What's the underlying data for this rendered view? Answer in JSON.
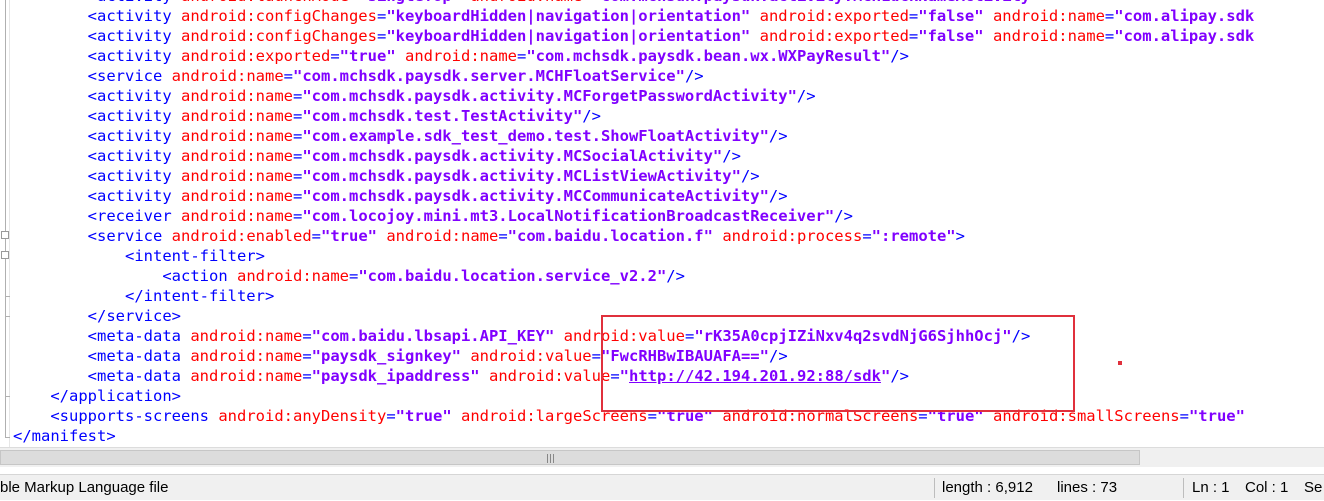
{
  "editor": {
    "lines": [
      [
        {
          "c": "p",
          "t": "<"
        },
        {
          "c": "t",
          "t": "activity"
        },
        {
          "c": "",
          "t": " "
        },
        {
          "c": "a",
          "t": "android:launchMode"
        },
        {
          "c": "p",
          "t": "="
        },
        {
          "c": "v",
          "t": "\"singleTop\""
        },
        {
          "c": "",
          "t": " "
        },
        {
          "c": "a",
          "t": "android:name"
        },
        {
          "c": "p",
          "t": "="
        },
        {
          "c": "v",
          "t": "\"com.mchsdk.paysdk.activity.MCHLuckNameActivity\""
        }
      ],
      [
        {
          "c": "p",
          "t": "<"
        },
        {
          "c": "t",
          "t": "activity"
        },
        {
          "c": "",
          "t": " "
        },
        {
          "c": "a",
          "t": "android:configChanges"
        },
        {
          "c": "p",
          "t": "="
        },
        {
          "c": "v",
          "t": "\"keyboardHidden|navigation|orientation\""
        },
        {
          "c": "",
          "t": " "
        },
        {
          "c": "a",
          "t": "android:exported"
        },
        {
          "c": "p",
          "t": "="
        },
        {
          "c": "v",
          "t": "\"false\""
        },
        {
          "c": "",
          "t": " "
        },
        {
          "c": "a",
          "t": "android:name"
        },
        {
          "c": "p",
          "t": "="
        },
        {
          "c": "v",
          "t": "\"com.alipay.sdk"
        }
      ],
      [
        {
          "c": "p",
          "t": "<"
        },
        {
          "c": "t",
          "t": "activity"
        },
        {
          "c": "",
          "t": " "
        },
        {
          "c": "a",
          "t": "android:configChanges"
        },
        {
          "c": "p",
          "t": "="
        },
        {
          "c": "v",
          "t": "\"keyboardHidden|navigation|orientation\""
        },
        {
          "c": "",
          "t": " "
        },
        {
          "c": "a",
          "t": "android:exported"
        },
        {
          "c": "p",
          "t": "="
        },
        {
          "c": "v",
          "t": "\"false\""
        },
        {
          "c": "",
          "t": " "
        },
        {
          "c": "a",
          "t": "android:name"
        },
        {
          "c": "p",
          "t": "="
        },
        {
          "c": "v",
          "t": "\"com.alipay.sdk"
        }
      ],
      [
        {
          "c": "p",
          "t": "<"
        },
        {
          "c": "t",
          "t": "activity"
        },
        {
          "c": "",
          "t": " "
        },
        {
          "c": "a",
          "t": "android:exported"
        },
        {
          "c": "p",
          "t": "="
        },
        {
          "c": "v",
          "t": "\"true\""
        },
        {
          "c": "",
          "t": " "
        },
        {
          "c": "a",
          "t": "android:name"
        },
        {
          "c": "p",
          "t": "="
        },
        {
          "c": "v",
          "t": "\"com.mchsdk.paysdk.bean.wx.WXPayResult\""
        },
        {
          "c": "p",
          "t": "/>"
        }
      ],
      [
        {
          "c": "p",
          "t": "<"
        },
        {
          "c": "t",
          "t": "service"
        },
        {
          "c": "",
          "t": " "
        },
        {
          "c": "a",
          "t": "android:name"
        },
        {
          "c": "p",
          "t": "="
        },
        {
          "c": "v",
          "t": "\"com.mchsdk.paysdk.server.MCHFloatService\""
        },
        {
          "c": "p",
          "t": "/>"
        }
      ],
      [
        {
          "c": "p",
          "t": "<"
        },
        {
          "c": "t",
          "t": "activity"
        },
        {
          "c": "",
          "t": " "
        },
        {
          "c": "a",
          "t": "android:name"
        },
        {
          "c": "p",
          "t": "="
        },
        {
          "c": "v",
          "t": "\"com.mchsdk.paysdk.activity.MCForgetPasswordActivity\""
        },
        {
          "c": "p",
          "t": "/>"
        }
      ],
      [
        {
          "c": "p",
          "t": "<"
        },
        {
          "c": "t",
          "t": "activity"
        },
        {
          "c": "",
          "t": " "
        },
        {
          "c": "a",
          "t": "android:name"
        },
        {
          "c": "p",
          "t": "="
        },
        {
          "c": "v",
          "t": "\"com.mchsdk.test.TestActivity\""
        },
        {
          "c": "p",
          "t": "/>"
        }
      ],
      [
        {
          "c": "p",
          "t": "<"
        },
        {
          "c": "t",
          "t": "activity"
        },
        {
          "c": "",
          "t": " "
        },
        {
          "c": "a",
          "t": "android:name"
        },
        {
          "c": "p",
          "t": "="
        },
        {
          "c": "v",
          "t": "\"com.example.sdk_test_demo.test.ShowFloatActivity\""
        },
        {
          "c": "p",
          "t": "/>"
        }
      ],
      [
        {
          "c": "p",
          "t": "<"
        },
        {
          "c": "t",
          "t": "activity"
        },
        {
          "c": "",
          "t": " "
        },
        {
          "c": "a",
          "t": "android:name"
        },
        {
          "c": "p",
          "t": "="
        },
        {
          "c": "v",
          "t": "\"com.mchsdk.paysdk.activity.MCSocialActivity\""
        },
        {
          "c": "p",
          "t": "/>"
        }
      ],
      [
        {
          "c": "p",
          "t": "<"
        },
        {
          "c": "t",
          "t": "activity"
        },
        {
          "c": "",
          "t": " "
        },
        {
          "c": "a",
          "t": "android:name"
        },
        {
          "c": "p",
          "t": "="
        },
        {
          "c": "v",
          "t": "\"com.mchsdk.paysdk.activity.MCListViewActivity\""
        },
        {
          "c": "p",
          "t": "/>"
        }
      ],
      [
        {
          "c": "p",
          "t": "<"
        },
        {
          "c": "t",
          "t": "activity"
        },
        {
          "c": "",
          "t": " "
        },
        {
          "c": "a",
          "t": "android:name"
        },
        {
          "c": "p",
          "t": "="
        },
        {
          "c": "v",
          "t": "\"com.mchsdk.paysdk.activity.MCCommunicateActivity\""
        },
        {
          "c": "p",
          "t": "/>"
        }
      ],
      [
        {
          "c": "p",
          "t": "<"
        },
        {
          "c": "t",
          "t": "receiver"
        },
        {
          "c": "",
          "t": " "
        },
        {
          "c": "a",
          "t": "android:name"
        },
        {
          "c": "p",
          "t": "="
        },
        {
          "c": "v",
          "t": "\"com.locojoy.mini.mt3.LocalNotificationBroadcastReceiver\""
        },
        {
          "c": "p",
          "t": "/>"
        }
      ],
      [
        {
          "c": "p",
          "t": "<"
        },
        {
          "c": "t",
          "t": "service"
        },
        {
          "c": "",
          "t": " "
        },
        {
          "c": "a",
          "t": "android:enabled"
        },
        {
          "c": "p",
          "t": "="
        },
        {
          "c": "v",
          "t": "\"true\""
        },
        {
          "c": "",
          "t": " "
        },
        {
          "c": "a",
          "t": "android:name"
        },
        {
          "c": "p",
          "t": "="
        },
        {
          "c": "v",
          "t": "\"com.baidu.location.f\""
        },
        {
          "c": "",
          "t": " "
        },
        {
          "c": "a",
          "t": "android:process"
        },
        {
          "c": "p",
          "t": "="
        },
        {
          "c": "v",
          "t": "\":remote\""
        },
        {
          "c": "p",
          "t": ">"
        }
      ],
      [
        {
          "c": "p",
          "t": "<"
        },
        {
          "c": "t",
          "t": "intent-filter"
        },
        {
          "c": "p",
          "t": ">"
        }
      ],
      [
        {
          "c": "p",
          "t": "<"
        },
        {
          "c": "t",
          "t": "action"
        },
        {
          "c": "",
          "t": " "
        },
        {
          "c": "a",
          "t": "android:name"
        },
        {
          "c": "p",
          "t": "="
        },
        {
          "c": "v",
          "t": "\"com.baidu.location.service_v2.2\""
        },
        {
          "c": "p",
          "t": "/>"
        }
      ],
      [
        {
          "c": "p",
          "t": "</"
        },
        {
          "c": "t",
          "t": "intent-filter"
        },
        {
          "c": "p",
          "t": ">"
        }
      ],
      [
        {
          "c": "p",
          "t": "</"
        },
        {
          "c": "t",
          "t": "service"
        },
        {
          "c": "p",
          "t": ">"
        }
      ],
      [
        {
          "c": "p",
          "t": "<"
        },
        {
          "c": "t",
          "t": "meta-data"
        },
        {
          "c": "",
          "t": " "
        },
        {
          "c": "a",
          "t": "android:name"
        },
        {
          "c": "p",
          "t": "="
        },
        {
          "c": "v",
          "t": "\"com.baidu.lbsapi.API_KEY\""
        },
        {
          "c": "",
          "t": " "
        },
        {
          "c": "a",
          "t": "android:value"
        },
        {
          "c": "p",
          "t": "="
        },
        {
          "c": "v",
          "t": "\"rK35A0cpjIZiNxv4q2svdNjG6SjhhOcj\""
        },
        {
          "c": "p",
          "t": "/>"
        }
      ],
      [
        {
          "c": "p",
          "t": "<"
        },
        {
          "c": "t",
          "t": "meta-data"
        },
        {
          "c": "",
          "t": " "
        },
        {
          "c": "a",
          "t": "android:name"
        },
        {
          "c": "p",
          "t": "="
        },
        {
          "c": "v",
          "t": "\"paysdk_signkey\""
        },
        {
          "c": "",
          "t": " "
        },
        {
          "c": "a",
          "t": "android:value"
        },
        {
          "c": "p",
          "t": "="
        },
        {
          "c": "v",
          "t": "\"FwcRHBwIBAUAFA==\""
        },
        {
          "c": "p",
          "t": "/>"
        }
      ],
      [
        {
          "c": "p",
          "t": "<"
        },
        {
          "c": "t",
          "t": "meta-data"
        },
        {
          "c": "",
          "t": " "
        },
        {
          "c": "a",
          "t": "android:name"
        },
        {
          "c": "p",
          "t": "="
        },
        {
          "c": "v",
          "t": "\"paysdk_ipaddress\""
        },
        {
          "c": "",
          "t": " "
        },
        {
          "c": "a",
          "t": "android:value"
        },
        {
          "c": "p",
          "t": "="
        },
        {
          "c": "v",
          "t": "\""
        },
        {
          "c": "v link",
          "t": "http://42.194.201.92:88/sdk"
        },
        {
          "c": "v",
          "t": "\""
        },
        {
          "c": "p",
          "t": "/>"
        }
      ],
      [
        {
          "c": "p",
          "t": "</"
        },
        {
          "c": "t",
          "t": "application"
        },
        {
          "c": "p",
          "t": ">"
        }
      ],
      [
        {
          "c": "p",
          "t": "<"
        },
        {
          "c": "t",
          "t": "supports-screens"
        },
        {
          "c": "",
          "t": " "
        },
        {
          "c": "a",
          "t": "android:anyDensity"
        },
        {
          "c": "p",
          "t": "="
        },
        {
          "c": "v",
          "t": "\"true\""
        },
        {
          "c": "",
          "t": " "
        },
        {
          "c": "a",
          "t": "android:largeScreens"
        },
        {
          "c": "p",
          "t": "="
        },
        {
          "c": "v",
          "t": "\"true\""
        },
        {
          "c": "",
          "t": " "
        },
        {
          "c": "a",
          "t": "android:normalScreens"
        },
        {
          "c": "p",
          "t": "="
        },
        {
          "c": "v",
          "t": "\"true\""
        },
        {
          "c": "",
          "t": " "
        },
        {
          "c": "a",
          "t": "android:smallScreens"
        },
        {
          "c": "p",
          "t": "="
        },
        {
          "c": "v",
          "t": "\"true\""
        }
      ],
      [
        {
          "c": "p",
          "t": "</"
        },
        {
          "c": "t",
          "t": "manifest"
        },
        {
          "c": "p",
          "t": ">"
        }
      ]
    ],
    "indent": [
      2,
      2,
      2,
      2,
      2,
      2,
      2,
      2,
      2,
      2,
      2,
      2,
      2,
      3,
      4,
      3,
      2,
      2,
      2,
      2,
      1,
      1,
      0
    ]
  },
  "horizontal_scrollbar": {
    "grip": "|||"
  },
  "statusbar": {
    "file_type": "ble Markup Language file",
    "length": "length : 6,912",
    "lines": "lines : 73",
    "ln": "Ln : 1",
    "col": "Col : 1",
    "sel": "Se"
  },
  "colors": {
    "tag": "#0000ff",
    "attribute": "#ff0000",
    "value": "#8000ff",
    "highlight_box": "#e0303c"
  }
}
